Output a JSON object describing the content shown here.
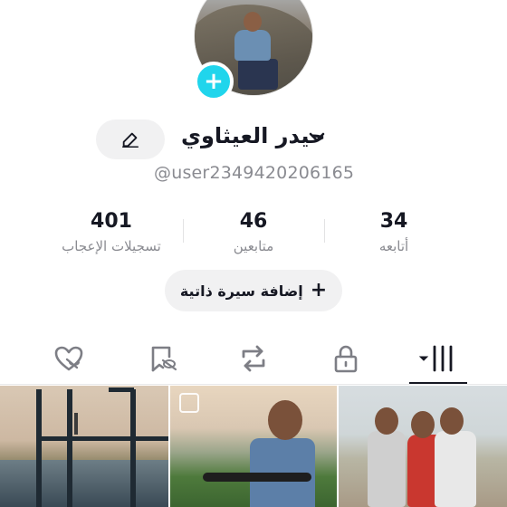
{
  "profile": {
    "display_name": "حيدر العيثاوي",
    "username": "@user2349420206165",
    "add_photo_symbol": "+"
  },
  "stats": {
    "following": {
      "value": "34",
      "label": "أتابعه"
    },
    "followers": {
      "value": "46",
      "label": "متابعين"
    },
    "likes": {
      "value": "401",
      "label": "تسجيلات الإعجاب"
    }
  },
  "bio_button": {
    "label": "إضافة سيرة ذاتية",
    "icon": "plus-icon"
  },
  "tabs": [
    {
      "id": "videos",
      "icon": "grid-columns-icon",
      "selected": true
    },
    {
      "id": "private",
      "icon": "lock-icon",
      "selected": false
    },
    {
      "id": "reposts",
      "icon": "repost-icon",
      "selected": false
    },
    {
      "id": "favorites",
      "icon": "bookmark-hidden-icon",
      "selected": false
    },
    {
      "id": "liked",
      "icon": "heart-hidden-icon",
      "selected": false
    }
  ],
  "colors": {
    "accent": "#20d5ec",
    "text_primary": "#161823",
    "text_secondary": "#8a8b91",
    "button_bg": "#f1f1f2"
  }
}
